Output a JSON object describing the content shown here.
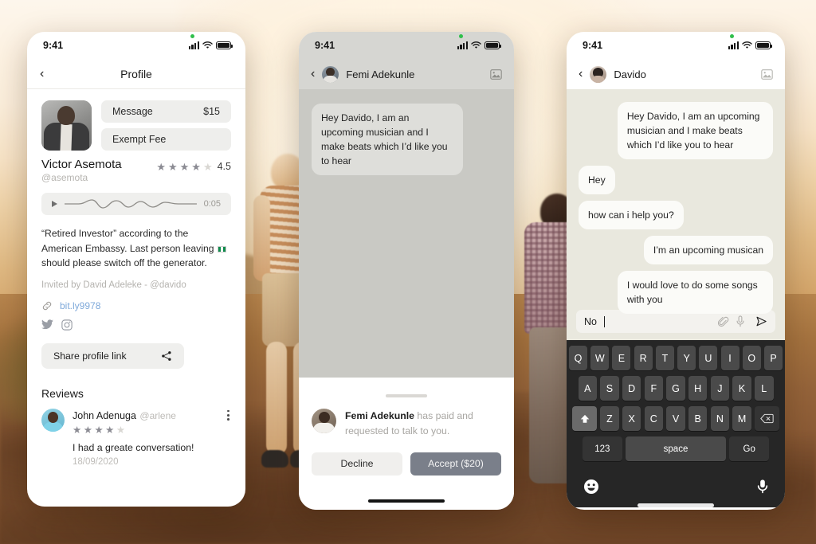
{
  "background": {
    "description": "golden-hour hillside photo with two people",
    "accent": "#c98a4e"
  },
  "phone1": {
    "status": {
      "time": "9:41"
    },
    "header": {
      "back_icon": "chevron-left-icon",
      "title": "Profile"
    },
    "profile": {
      "avatar": "profile-photo-victor",
      "name": "Victor Asemota",
      "handle": "@asemota",
      "rating_value": "4.5",
      "stars_filled": 4,
      "stars_total": 5,
      "actions": [
        {
          "label": "Message",
          "value": "$15"
        },
        {
          "label": "Exempt Fee",
          "value": ""
        }
      ],
      "audio": {
        "play_icon": "play-icon",
        "duration": "0:05"
      },
      "bio_part1": "“Retired Investor” according to the American Embassy. Last person leaving ",
      "bio_part2": " should please switch off the generator.",
      "invited_by": "Invited by David Adeleke - @davido",
      "link": {
        "icon": "link-icon",
        "text": "bit.ly9978"
      },
      "socials": [
        "twitter-icon",
        "instagram-icon"
      ],
      "share": {
        "label": "Share profile link",
        "icon": "share-icon"
      }
    },
    "reviews": {
      "heading": "Reviews",
      "items": [
        {
          "name": "John Adenuga",
          "handle": "@arlene",
          "stars_filled": 4,
          "stars_total": 5,
          "text": "I had a greate conversation!",
          "date": "18/09/2020",
          "menu_icon": "kebab-menu-icon"
        }
      ]
    }
  },
  "phone2": {
    "status": {
      "time": "9:41"
    },
    "header": {
      "back_icon": "chevron-left-icon",
      "name": "Femi Adekunle",
      "right_icon": "image-gallery-icon"
    },
    "messages": [
      {
        "from": "them",
        "text": "Hey Davido, I am an upcoming musician and I make beats which I’d like you to hear"
      }
    ],
    "sheet": {
      "avatar": "femi-avatar",
      "name": "Femi Adekunle",
      "message": " has paid and requested to talk to you.",
      "decline_label": "Decline",
      "accept_label": "Accept ($20)"
    }
  },
  "phone3": {
    "status": {
      "time": "9:41"
    },
    "header": {
      "back_icon": "chevron-left-icon",
      "name": "Davido",
      "right_icon": "image-gallery-icon"
    },
    "messages": [
      {
        "from": "me",
        "text": "Hey Davido, I am an upcoming musician and I make beats which I’d like you to hear"
      },
      {
        "from": "them",
        "text": "Hey"
      },
      {
        "from": "them",
        "text": "how can i help you?"
      },
      {
        "from": "me",
        "text": "I’m an upcoming musican"
      },
      {
        "from": "me",
        "text": "I would love to do some songs with you"
      }
    ],
    "input": {
      "value": "No",
      "attach_icon": "paperclip-icon",
      "mic_icon": "microphone-icon",
      "send_icon": "send-icon"
    },
    "keyboard": {
      "row1": [
        "Q",
        "W",
        "E",
        "R",
        "T",
        "Y",
        "U",
        "I",
        "O",
        "P"
      ],
      "row2": [
        "A",
        "S",
        "D",
        "F",
        "G",
        "H",
        "J",
        "K",
        "L"
      ],
      "row3": [
        "Z",
        "X",
        "C",
        "V",
        "B",
        "N",
        "M"
      ],
      "shift_icon": "shift-icon",
      "delete_icon": "backspace-icon",
      "num_label": "123",
      "space_label": "space",
      "go_label": "Go",
      "emoji_icon": "emoji-icon",
      "dictate_icon": "microphone-icon"
    }
  }
}
